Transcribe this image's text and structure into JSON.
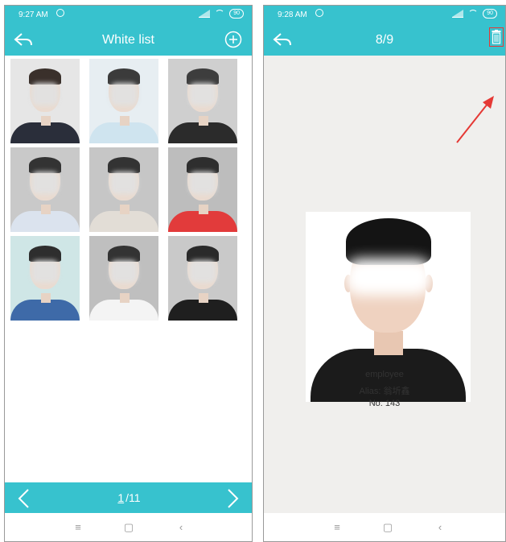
{
  "left": {
    "status_time": "9:27 AM",
    "battery": "90",
    "title": "White list",
    "pagination": {
      "current": "1",
      "total": "/11"
    },
    "photos": [
      {
        "hair": "#3a302b",
        "shirt": "#2a2e3a",
        "bg": "#e6e6e6"
      },
      {
        "hair": "#3b3b3b",
        "shirt": "#cfe4ef",
        "bg": "#e7eef2"
      },
      {
        "hair": "#3d3d3d",
        "shirt": "#2b2b2b",
        "bg": "#cfcfcf"
      },
      {
        "hair": "#333333",
        "shirt": "#dbe3ee",
        "bg": "#c9c9c9"
      },
      {
        "hair": "#333333",
        "shirt": "#e2ddd6",
        "bg": "#c6c6c6"
      },
      {
        "hair": "#2e2e2e",
        "shirt": "#e23b3b",
        "bg": "#bdbdbd"
      },
      {
        "hair": "#2e2e2e",
        "shirt": "#3e6aa8",
        "bg": "#cfe6e6"
      },
      {
        "hair": "#333333",
        "shirt": "#f4f4f4",
        "bg": "#bfbfbf"
      },
      {
        "hair": "#2a2a2a",
        "shirt": "#1f1f1f",
        "bg": "#c9c9c9"
      }
    ]
  },
  "right": {
    "status_time": "9:28 AM",
    "battery": "90",
    "title": "8/9",
    "detail": {
      "name": "employee",
      "alias": "Alias: 翁圻鑫",
      "number": "No: 143"
    }
  },
  "sysnav": {
    "menu": "≡",
    "home": "▢",
    "back": "‹"
  },
  "colors": {
    "accent": "#37c2ce",
    "alert": "#e53935"
  }
}
